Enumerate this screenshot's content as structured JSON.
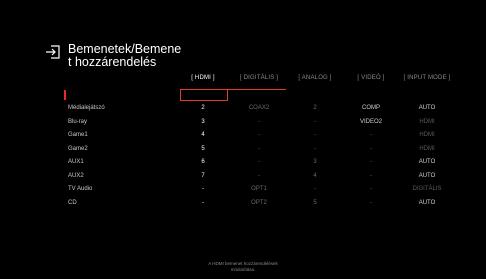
{
  "title": "Bemenetek/Bemene\nt hozzárendelés",
  "columns": [
    "[ HDMI ]",
    "[ DIGITÁLIS ]",
    "[ ANALOG ]",
    "[ VIDEÓ ]",
    "[ INPUT MODE ]"
  ],
  "active_column": 0,
  "rows": [
    {
      "label": "Médialejátszó",
      "cells": [
        "2",
        "COAX2",
        "2",
        "COMP",
        "AUTO"
      ]
    },
    {
      "label": "Blu-ray",
      "cells": [
        "3",
        "-",
        "-",
        "VIDEO2",
        "HDMI"
      ]
    },
    {
      "label": "Game1",
      "cells": [
        "4",
        "-",
        "-",
        "-",
        "HDMI"
      ]
    },
    {
      "label": "Game2",
      "cells": [
        "5",
        "-",
        "-",
        "-",
        "HDMI"
      ]
    },
    {
      "label": "AUX1",
      "cells": [
        "6",
        "-",
        "3",
        "-",
        "AUTO"
      ]
    },
    {
      "label": "AUX2",
      "cells": [
        "7",
        "-",
        "4",
        "-",
        "AUTO"
      ]
    },
    {
      "label": "TV Audio",
      "cells": [
        "-",
        "OPT1",
        "-",
        "-",
        "DIGITÁLIS"
      ]
    },
    {
      "label": "CD",
      "cells": [
        "-",
        "OPT2",
        "5",
        "-",
        "AUTO"
      ]
    }
  ],
  "footer": "A HDMI bemenet hozzárendelések\nmódosítása.",
  "colors": {
    "accent": "#e53b2b",
    "background": "#000000"
  },
  "icon": "input-arrow-icon"
}
